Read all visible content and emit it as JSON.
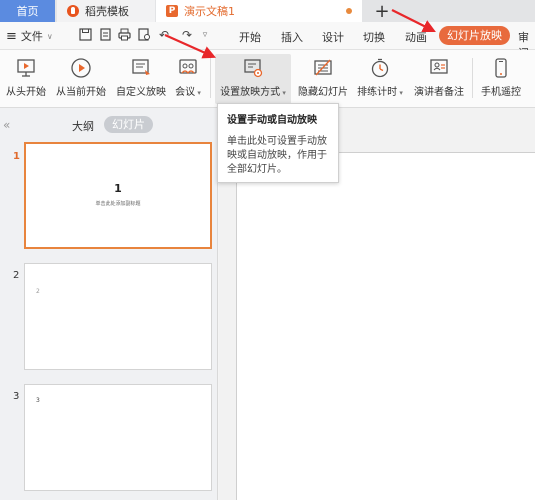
{
  "tabs": {
    "home": "首页",
    "docer": "稻壳模板",
    "document": "演示文稿1",
    "add": "+"
  },
  "menu": {
    "file": "文件",
    "tabs": [
      {
        "label": "开始"
      },
      {
        "label": "插入"
      },
      {
        "label": "设计"
      },
      {
        "label": "切换"
      },
      {
        "label": "动画"
      },
      {
        "label": "幻灯片放映",
        "active": true
      },
      {
        "label": "审阅"
      }
    ]
  },
  "ribbon": {
    "from_start": "从头开始",
    "from_current": "从当前开始",
    "custom_show": "自定义放映",
    "meeting": "会议",
    "setup_show": "设置放映方式",
    "hide_slide": "隐藏幻灯片",
    "rehearse": "排练计时",
    "presenter_notes": "演讲者备注",
    "phone_remote": "手机遥控"
  },
  "sidebar": {
    "collapse": "«",
    "outline_tab": "大纲",
    "slides_tab": "幻灯片",
    "slides": [
      {
        "number": "1",
        "title": "1",
        "subtitle": "单击此处添加副标题",
        "selected": true
      },
      {
        "number": "2",
        "text": "2"
      },
      {
        "number": "3",
        "text": "3"
      }
    ]
  },
  "tooltip": {
    "title": "设置手动或自动放映",
    "body": "单击此处可设置手动放映或自动放映，作用于全部幻灯片。"
  },
  "colors": {
    "accent": "#e86a3d",
    "home_tab": "#5b8be0",
    "arrow": "#e8272a"
  },
  "icons": {
    "collapse": "double-chevron-left-icon",
    "from_start": "play-from-start-icon",
    "from_current": "play-icon",
    "custom_show": "custom-slideshow-icon",
    "meeting": "meeting-icon",
    "setup_show": "slideshow-settings-icon",
    "hide_slide": "hide-slide-icon",
    "rehearse": "stopwatch-icon",
    "presenter_notes": "presenter-notes-icon",
    "phone_remote": "phone-icon"
  }
}
